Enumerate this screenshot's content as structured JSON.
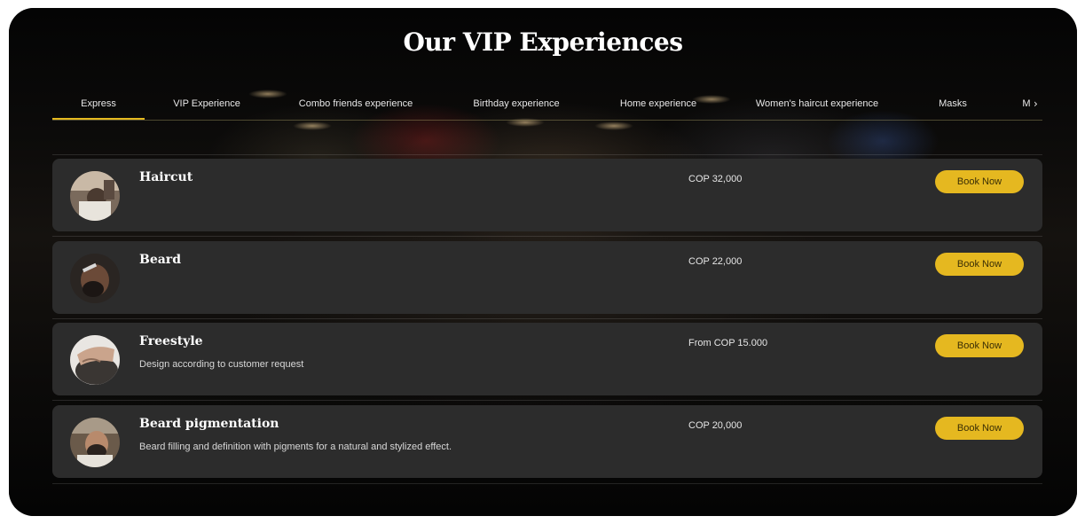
{
  "section": {
    "title": "Our VIP Experiences"
  },
  "tabs": [
    {
      "label": "Express",
      "active": true
    },
    {
      "label": "VIP Experience",
      "active": false
    },
    {
      "label": "Combo friends experience",
      "active": false
    },
    {
      "label": "Birthday experience",
      "active": false
    },
    {
      "label": "Home experience",
      "active": false
    },
    {
      "label": "Women's haircut experience",
      "active": false
    },
    {
      "label": "Masks",
      "active": false
    },
    {
      "label": "M",
      "active": false
    }
  ],
  "tabs_next_icon": "chevron-right-icon",
  "services": [
    {
      "name": "Haircut",
      "description": "",
      "price": "COP 32,000",
      "button": "Book Now",
      "image": "haircut-photo"
    },
    {
      "name": "Beard",
      "description": "",
      "price": "COP 22,000",
      "button": "Book Now",
      "image": "beard-photo"
    },
    {
      "name": "Freestyle",
      "description": "Design according to customer request",
      "price": "From COP 15.000",
      "button": "Book Now",
      "image": "freestyle-photo"
    },
    {
      "name": "Beard pigmentation",
      "description": "Beard filling and definition with pigments for a natural and stylized effect.",
      "price": "COP 20,000",
      "button": "Book Now",
      "image": "beard-pigmentation-photo"
    }
  ],
  "colors": {
    "accent": "#e5b820",
    "card": "#2c2c2c",
    "background": "#070605"
  }
}
